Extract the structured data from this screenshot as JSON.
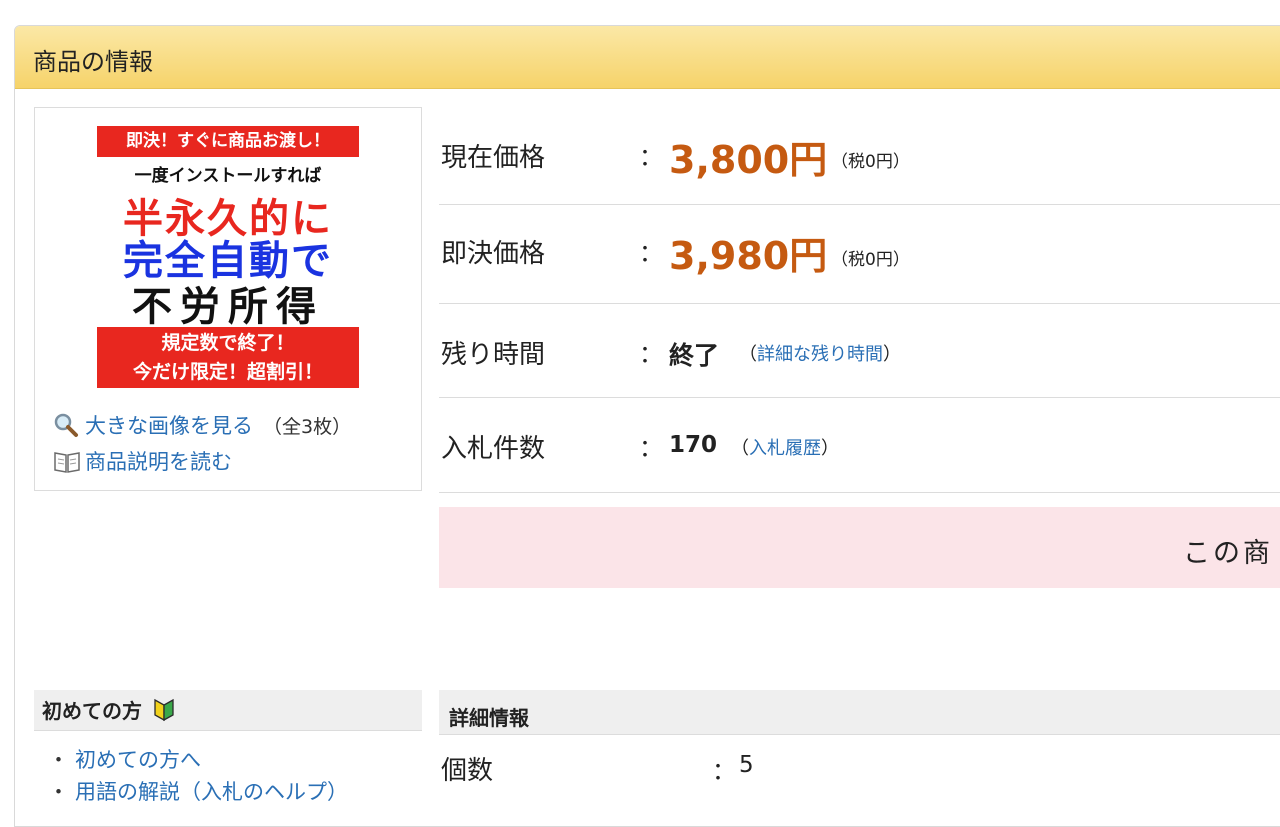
{
  "panel": {
    "title": "商品の情報"
  },
  "image": {
    "banner_top": "即決！すぐに商品お渡し！",
    "subtitle": "一度インストールすれば",
    "line1": "半永久的に",
    "line2": "完全自動で",
    "line3": "不労所得",
    "banner_bottom_1": "規定数で終了！",
    "banner_bottom_2": "今だけ限定！超割引！",
    "view_large_label": "大きな画像を見る",
    "image_count": "（全3枚）",
    "read_description_label": "商品説明を読む",
    "icons": {
      "zoom": "magnifier-icon",
      "book": "book-icon"
    }
  },
  "info": {
    "current_price": {
      "label": "現在価格",
      "colon": "：",
      "value": "3,800円",
      "tax": "（税0円）"
    },
    "buyout_price": {
      "label": "即決価格",
      "colon": "：",
      "value": "3,980円",
      "tax": "（税0円）"
    },
    "time_left": {
      "label": "残り時間",
      "colon": "：",
      "value": "終了",
      "open_paren": "（",
      "link": "詳細な残り時間",
      "close_paren": "）"
    },
    "bids": {
      "label": "入札件数",
      "colon": "：",
      "value": "170",
      "open_paren": "（",
      "link": "入札履歴",
      "close_paren": "）"
    }
  },
  "alert": {
    "text": "この商"
  },
  "beginner": {
    "title": "初めての方",
    "icon": "beginner-mark-icon",
    "links": [
      "初めての方へ",
      "用語の解説（入札のヘルプ）"
    ]
  },
  "details": {
    "title": "詳細情報",
    "rows": [
      {
        "label": "個数",
        "colon": "：",
        "value": "5"
      }
    ]
  },
  "colors": {
    "price": "#c55a11",
    "link": "#2a6fb5",
    "header_gradient_top": "#fbe8a6",
    "header_gradient_bottom": "#f6d36a",
    "alert_bg": "#fbe4e8"
  }
}
